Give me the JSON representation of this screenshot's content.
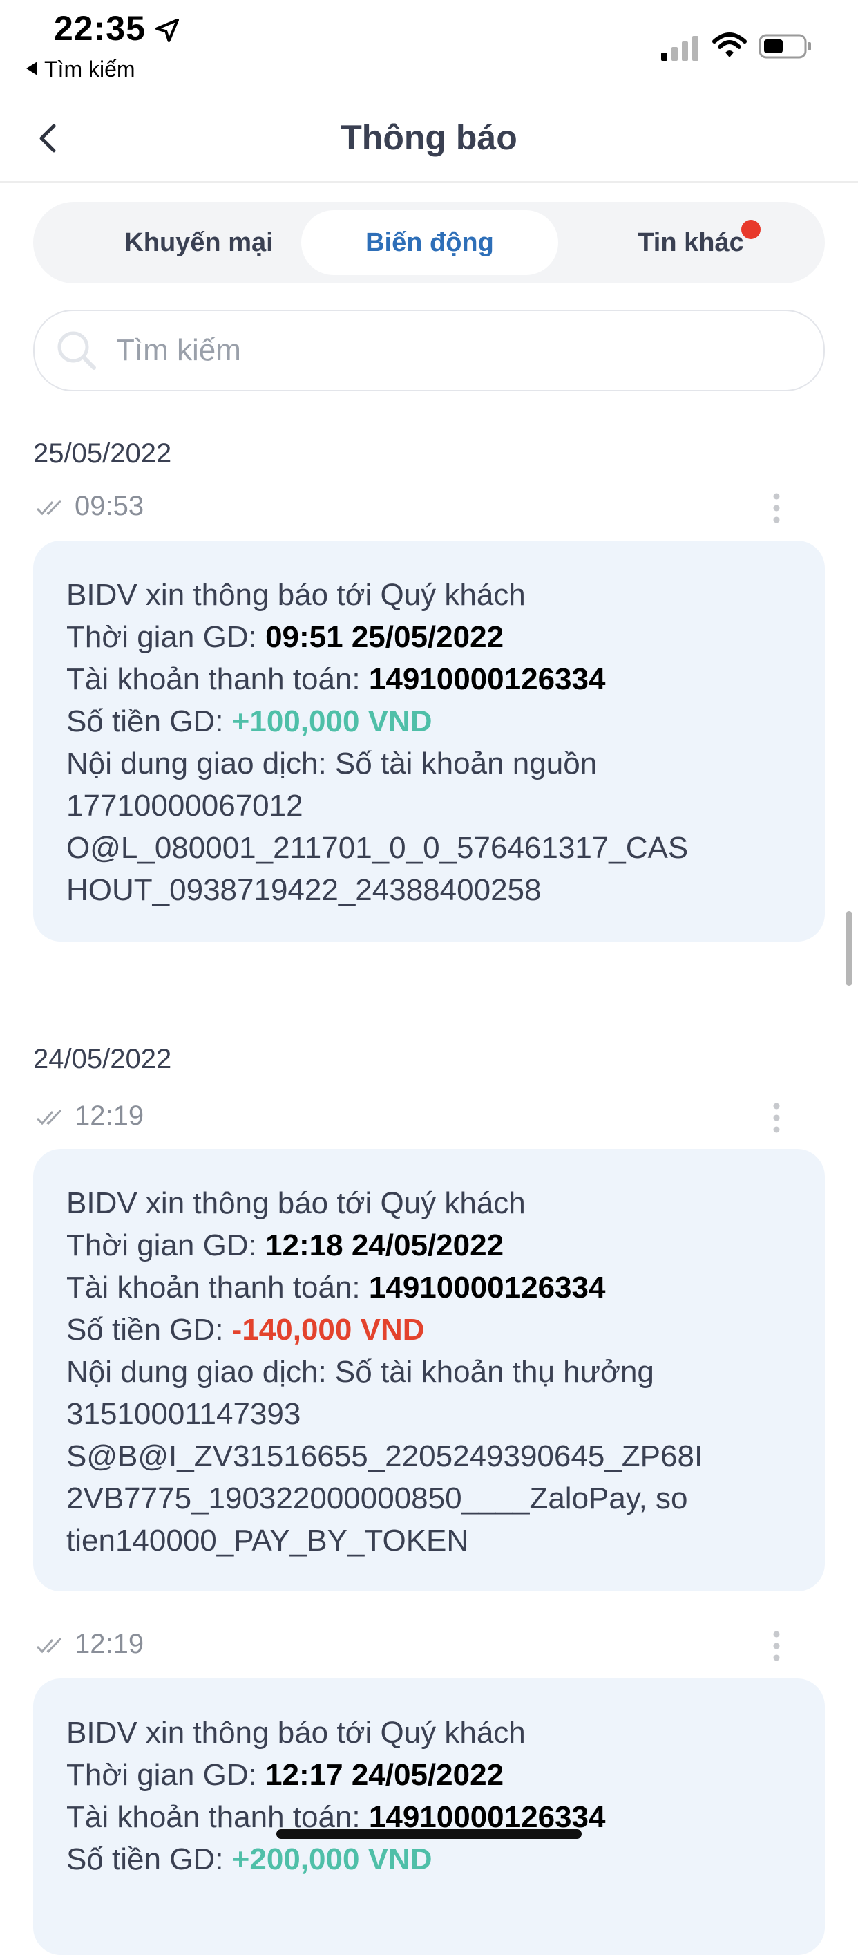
{
  "status_bar": {
    "time": "22:35",
    "back_app": "Tìm kiếm",
    "location_icon": "location-arrow-icon",
    "signal_icon": "cellular-signal-icon",
    "wifi_icon": "wifi-icon",
    "battery_icon": "battery-icon",
    "battery_level": 0.5
  },
  "header": {
    "title": "Thông báo",
    "back_icon": "chevron-left-icon"
  },
  "tabs": [
    {
      "label": "Khuyến mại",
      "active": false
    },
    {
      "label": "Biến động",
      "active": true
    },
    {
      "label": "Tin khác",
      "active": false,
      "badge": true
    }
  ],
  "search": {
    "placeholder": "Tìm kiếm",
    "value": ""
  },
  "colors": {
    "accent": "#2e6fb8",
    "credit": "#4fbfa8",
    "debit": "#e3432d",
    "card_bg": "#eef4fb",
    "badge": "#e8392b"
  },
  "groups": [
    {
      "date": "25/05/2022",
      "items": [
        {
          "time": "09:53",
          "intro": "BIDV xin thông báo tới Quý khách",
          "time_label": "Thời gian GD: ",
          "time_value": "09:51 25/05/2022",
          "account_label": "Tài khoản thanh toán: ",
          "account_value": "14910000126334",
          "amount_label": "Số tiền GD: ",
          "amount_value": "+100,000 VND",
          "content_lines": [
            "Nội dung giao dịch: Số tài khoản nguồn",
            "17710000067012",
            "O@L_080001_211701_0_0_576461317_CAS",
            "HOUT_0938719422_24388400258"
          ]
        }
      ]
    },
    {
      "date": "24/05/2022",
      "items": [
        {
          "time": "12:19",
          "intro": "BIDV xin thông báo tới Quý khách",
          "time_label": "Thời gian GD: ",
          "time_value": "12:18 24/05/2022",
          "account_label": "Tài khoản thanh toán: ",
          "account_value": "14910000126334",
          "amount_label": "Số tiền GD: ",
          "amount_value": "-140,000 VND",
          "content_lines": [
            "Nội dung giao dịch: Số tài khoản thụ hưởng",
            "31510001147393",
            "S@B@I_ZV31516655_2205249390645_ZP68I",
            "2VB7775_190322000000850____ZaloPay, so",
            "tien140000_PAY_BY_TOKEN"
          ]
        },
        {
          "time": "12:19",
          "intro": "BIDV xin thông báo tới Quý khách",
          "time_label": "Thời gian GD: ",
          "time_value": "12:17 24/05/2022",
          "account_label": "Tài khoản thanh toán: ",
          "account_value": "14910000126334",
          "amount_label": "Số tiền GD: ",
          "amount_value": "+200,000 VND"
        }
      ]
    }
  ]
}
